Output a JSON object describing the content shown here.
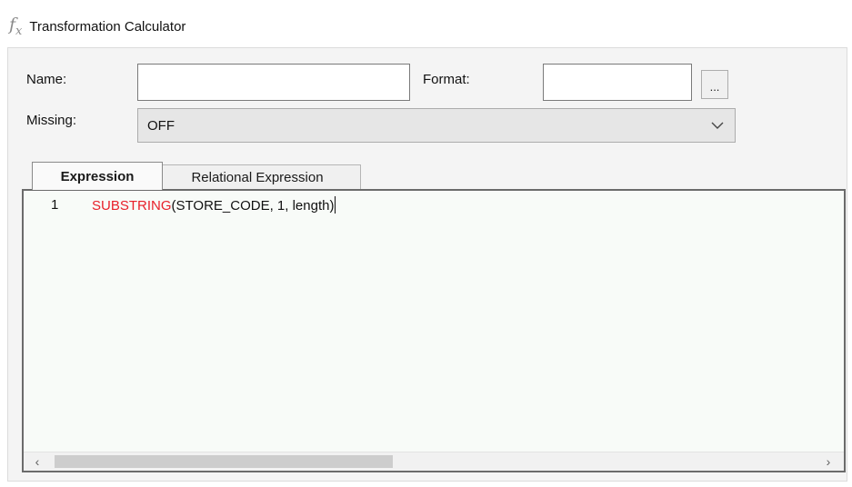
{
  "window": {
    "title": "Transformation Calculator",
    "icon": "function-fx-icon"
  },
  "form": {
    "name_label": "Name:",
    "name_value": "",
    "format_label": "Format:",
    "format_value": "",
    "format_browse_label": "...",
    "missing_label": "Missing:",
    "missing_value": "OFF"
  },
  "tabs": [
    {
      "label": "Expression",
      "active": true
    },
    {
      "label": "Relational Expression",
      "active": false
    }
  ],
  "editor": {
    "lines": [
      {
        "number": "1",
        "function": "SUBSTRING",
        "args": "(STORE_CODE, 1, length)"
      }
    ],
    "function_color": "#e8202a",
    "scroll": {
      "left_arrow": "‹",
      "right_arrow": "›"
    }
  }
}
